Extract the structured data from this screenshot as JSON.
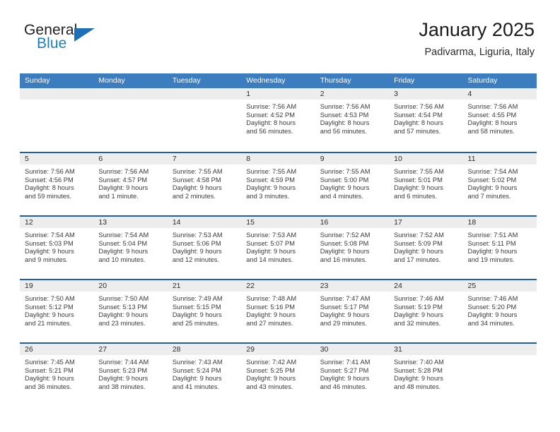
{
  "brand": {
    "word_one": "General",
    "word_two": "Blue",
    "flag_icon": "triangle-flag-icon",
    "accent_color": "#1a7fc1"
  },
  "header": {
    "title": "January 2025",
    "subtitle": "Padivarma, Liguria, Italy"
  },
  "theme": {
    "header_row_bg": "#3b7dbf",
    "week_separator": "#1f5fa9",
    "daynum_band_bg": "#ededed",
    "text_color": "#3a3a3a"
  },
  "calendar": {
    "weekdays": [
      "Sunday",
      "Monday",
      "Tuesday",
      "Wednesday",
      "Thursday",
      "Friday",
      "Saturday"
    ],
    "weeks": [
      [
        {
          "day": "",
          "empty": true
        },
        {
          "day": "",
          "empty": true
        },
        {
          "day": "",
          "empty": true
        },
        {
          "day": "1",
          "sunrise": "Sunrise: 7:56 AM",
          "sunset": "Sunset: 4:52 PM",
          "daylight_line1": "Daylight: 8 hours",
          "daylight_line2": "and 56 minutes."
        },
        {
          "day": "2",
          "sunrise": "Sunrise: 7:56 AM",
          "sunset": "Sunset: 4:53 PM",
          "daylight_line1": "Daylight: 8 hours",
          "daylight_line2": "and 56 minutes."
        },
        {
          "day": "3",
          "sunrise": "Sunrise: 7:56 AM",
          "sunset": "Sunset: 4:54 PM",
          "daylight_line1": "Daylight: 8 hours",
          "daylight_line2": "and 57 minutes."
        },
        {
          "day": "4",
          "sunrise": "Sunrise: 7:56 AM",
          "sunset": "Sunset: 4:55 PM",
          "daylight_line1": "Daylight: 8 hours",
          "daylight_line2": "and 58 minutes."
        }
      ],
      [
        {
          "day": "5",
          "sunrise": "Sunrise: 7:56 AM",
          "sunset": "Sunset: 4:56 PM",
          "daylight_line1": "Daylight: 8 hours",
          "daylight_line2": "and 59 minutes."
        },
        {
          "day": "6",
          "sunrise": "Sunrise: 7:56 AM",
          "sunset": "Sunset: 4:57 PM",
          "daylight_line1": "Daylight: 9 hours",
          "daylight_line2": "and 1 minute."
        },
        {
          "day": "7",
          "sunrise": "Sunrise: 7:55 AM",
          "sunset": "Sunset: 4:58 PM",
          "daylight_line1": "Daylight: 9 hours",
          "daylight_line2": "and 2 minutes."
        },
        {
          "day": "8",
          "sunrise": "Sunrise: 7:55 AM",
          "sunset": "Sunset: 4:59 PM",
          "daylight_line1": "Daylight: 9 hours",
          "daylight_line2": "and 3 minutes."
        },
        {
          "day": "9",
          "sunrise": "Sunrise: 7:55 AM",
          "sunset": "Sunset: 5:00 PM",
          "daylight_line1": "Daylight: 9 hours",
          "daylight_line2": "and 4 minutes."
        },
        {
          "day": "10",
          "sunrise": "Sunrise: 7:55 AM",
          "sunset": "Sunset: 5:01 PM",
          "daylight_line1": "Daylight: 9 hours",
          "daylight_line2": "and 6 minutes."
        },
        {
          "day": "11",
          "sunrise": "Sunrise: 7:54 AM",
          "sunset": "Sunset: 5:02 PM",
          "daylight_line1": "Daylight: 9 hours",
          "daylight_line2": "and 7 minutes."
        }
      ],
      [
        {
          "day": "12",
          "sunrise": "Sunrise: 7:54 AM",
          "sunset": "Sunset: 5:03 PM",
          "daylight_line1": "Daylight: 9 hours",
          "daylight_line2": "and 9 minutes."
        },
        {
          "day": "13",
          "sunrise": "Sunrise: 7:54 AM",
          "sunset": "Sunset: 5:04 PM",
          "daylight_line1": "Daylight: 9 hours",
          "daylight_line2": "and 10 minutes."
        },
        {
          "day": "14",
          "sunrise": "Sunrise: 7:53 AM",
          "sunset": "Sunset: 5:06 PM",
          "daylight_line1": "Daylight: 9 hours",
          "daylight_line2": "and 12 minutes."
        },
        {
          "day": "15",
          "sunrise": "Sunrise: 7:53 AM",
          "sunset": "Sunset: 5:07 PM",
          "daylight_line1": "Daylight: 9 hours",
          "daylight_line2": "and 14 minutes."
        },
        {
          "day": "16",
          "sunrise": "Sunrise: 7:52 AM",
          "sunset": "Sunset: 5:08 PM",
          "daylight_line1": "Daylight: 9 hours",
          "daylight_line2": "and 16 minutes."
        },
        {
          "day": "17",
          "sunrise": "Sunrise: 7:52 AM",
          "sunset": "Sunset: 5:09 PM",
          "daylight_line1": "Daylight: 9 hours",
          "daylight_line2": "and 17 minutes."
        },
        {
          "day": "18",
          "sunrise": "Sunrise: 7:51 AM",
          "sunset": "Sunset: 5:11 PM",
          "daylight_line1": "Daylight: 9 hours",
          "daylight_line2": "and 19 minutes."
        }
      ],
      [
        {
          "day": "19",
          "sunrise": "Sunrise: 7:50 AM",
          "sunset": "Sunset: 5:12 PM",
          "daylight_line1": "Daylight: 9 hours",
          "daylight_line2": "and 21 minutes."
        },
        {
          "day": "20",
          "sunrise": "Sunrise: 7:50 AM",
          "sunset": "Sunset: 5:13 PM",
          "daylight_line1": "Daylight: 9 hours",
          "daylight_line2": "and 23 minutes."
        },
        {
          "day": "21",
          "sunrise": "Sunrise: 7:49 AM",
          "sunset": "Sunset: 5:15 PM",
          "daylight_line1": "Daylight: 9 hours",
          "daylight_line2": "and 25 minutes."
        },
        {
          "day": "22",
          "sunrise": "Sunrise: 7:48 AM",
          "sunset": "Sunset: 5:16 PM",
          "daylight_line1": "Daylight: 9 hours",
          "daylight_line2": "and 27 minutes."
        },
        {
          "day": "23",
          "sunrise": "Sunrise: 7:47 AM",
          "sunset": "Sunset: 5:17 PM",
          "daylight_line1": "Daylight: 9 hours",
          "daylight_line2": "and 29 minutes."
        },
        {
          "day": "24",
          "sunrise": "Sunrise: 7:46 AM",
          "sunset": "Sunset: 5:19 PM",
          "daylight_line1": "Daylight: 9 hours",
          "daylight_line2": "and 32 minutes."
        },
        {
          "day": "25",
          "sunrise": "Sunrise: 7:46 AM",
          "sunset": "Sunset: 5:20 PM",
          "daylight_line1": "Daylight: 9 hours",
          "daylight_line2": "and 34 minutes."
        }
      ],
      [
        {
          "day": "26",
          "sunrise": "Sunrise: 7:45 AM",
          "sunset": "Sunset: 5:21 PM",
          "daylight_line1": "Daylight: 9 hours",
          "daylight_line2": "and 36 minutes."
        },
        {
          "day": "27",
          "sunrise": "Sunrise: 7:44 AM",
          "sunset": "Sunset: 5:23 PM",
          "daylight_line1": "Daylight: 9 hours",
          "daylight_line2": "and 38 minutes."
        },
        {
          "day": "28",
          "sunrise": "Sunrise: 7:43 AM",
          "sunset": "Sunset: 5:24 PM",
          "daylight_line1": "Daylight: 9 hours",
          "daylight_line2": "and 41 minutes."
        },
        {
          "day": "29",
          "sunrise": "Sunrise: 7:42 AM",
          "sunset": "Sunset: 5:25 PM",
          "daylight_line1": "Daylight: 9 hours",
          "daylight_line2": "and 43 minutes."
        },
        {
          "day": "30",
          "sunrise": "Sunrise: 7:41 AM",
          "sunset": "Sunset: 5:27 PM",
          "daylight_line1": "Daylight: 9 hours",
          "daylight_line2": "and 46 minutes."
        },
        {
          "day": "31",
          "sunrise": "Sunrise: 7:40 AM",
          "sunset": "Sunset: 5:28 PM",
          "daylight_line1": "Daylight: 9 hours",
          "daylight_line2": "and 48 minutes."
        },
        {
          "day": "",
          "empty": true
        }
      ]
    ]
  }
}
